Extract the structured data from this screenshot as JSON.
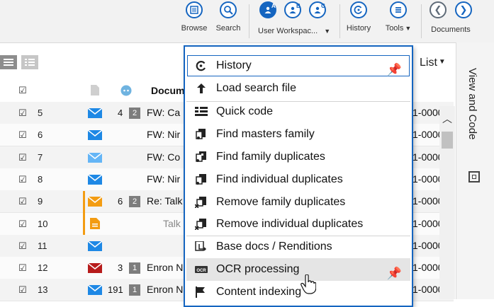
{
  "toolbar": {
    "browse_label": "Browse",
    "search_label": "Search",
    "workspace_label": "User Workspac...",
    "workspace_letters": [
      "A",
      "B",
      "C"
    ],
    "history_label": "History",
    "tools_label": "Tools",
    "documents_label": "Documents",
    "accent": "#1565c0"
  },
  "view": {
    "mode_label": "List"
  },
  "grid": {
    "column_header_document": "Docum",
    "rows": [
      {
        "num": "5",
        "count": "4",
        "badge": "2",
        "subject": "FW: Ca",
        "control": "1-0000",
        "icon": "envelope-blue"
      },
      {
        "num": "6",
        "count": "",
        "badge": "",
        "subject": "FW: Nir",
        "control": "1-0000",
        "icon": "envelope-blue"
      },
      {
        "num": "7",
        "count": "",
        "badge": "",
        "subject": "FW: Co",
        "control": "1-0000",
        "icon": "envelope-light-blue"
      },
      {
        "num": "8",
        "count": "",
        "badge": "",
        "subject": "FW: Nir",
        "control": "1-0000",
        "icon": "envelope-blue"
      },
      {
        "num": "9",
        "count": "6",
        "badge": "2",
        "subject": "Re: Talk",
        "control": "1-0000",
        "icon": "envelope-orange"
      },
      {
        "num": "10",
        "count": "",
        "badge": "",
        "subject": "Talk",
        "control": "1-0000",
        "icon": "document-orange"
      },
      {
        "num": "11",
        "count": "",
        "badge": "",
        "subject": "",
        "control": "1-0000",
        "icon": "envelope-blue"
      },
      {
        "num": "12",
        "count": "3",
        "badge": "1",
        "subject": "Enron N",
        "control": "1-0000",
        "icon": "envelope-red"
      },
      {
        "num": "13",
        "count": "191",
        "badge": "1",
        "subject": "Enron N",
        "control": "1-0000",
        "icon": "envelope-blue"
      }
    ]
  },
  "right_panel": {
    "title": "View and Code"
  },
  "menu": {
    "items": [
      {
        "label": "History",
        "icon": "history-icon",
        "pinned": true
      },
      {
        "label": "Load search file",
        "icon": "upload-arrow-icon",
        "pinned": false
      },
      {
        "label": "Quick code",
        "icon": "quick-code-icon",
        "pinned": false
      },
      {
        "label": "Find masters family",
        "icon": "find-masters-family-icon",
        "pinned": false
      },
      {
        "label": "Find family duplicates",
        "icon": "find-family-duplicates-icon",
        "pinned": false
      },
      {
        "label": "Find individual duplicates",
        "icon": "find-individual-duplicates-icon",
        "pinned": false
      },
      {
        "label": "Remove family duplicates",
        "icon": "remove-family-duplicates-icon",
        "pinned": false
      },
      {
        "label": "Remove individual duplicates",
        "icon": "remove-individual-duplicates-icon",
        "pinned": false
      },
      {
        "label": "Base docs / Renditions",
        "icon": "renditions-icon",
        "pinned": false
      },
      {
        "label": "OCR processing",
        "icon": "ocr-icon",
        "pinned": true
      },
      {
        "label": "Content indexing",
        "icon": "flag-icon",
        "pinned": false
      }
    ]
  }
}
